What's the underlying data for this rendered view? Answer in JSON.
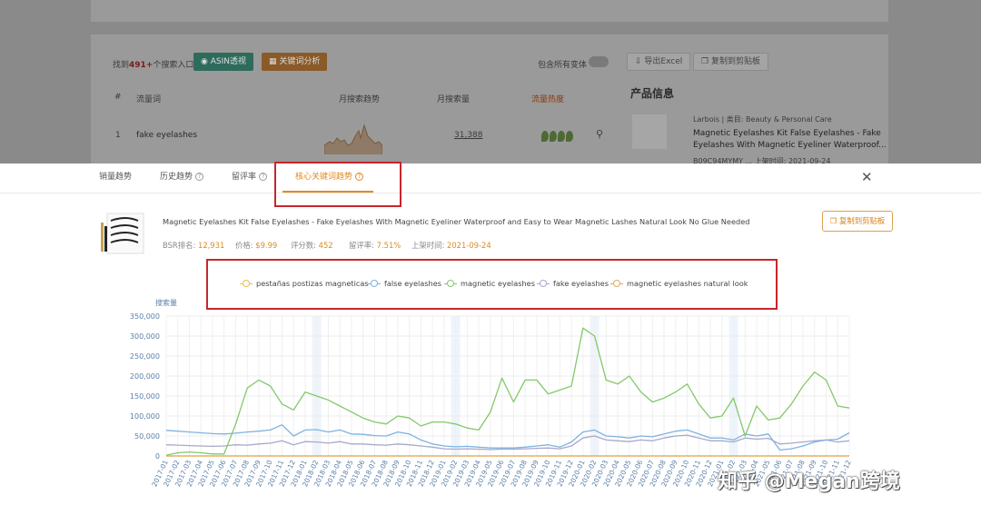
{
  "background": {
    "found_text": "找到",
    "found_count": "491+",
    "found_suffix": "个搜索入口",
    "asin_btn": "ASIN透视",
    "keyword_btn": "关键词分析",
    "include_variants": "包含所有变体",
    "export_btn": "导出Excel",
    "copy_btn": "复制到剪贴板",
    "col_hash": "#",
    "col_keyword": "流量词",
    "col_trend": "月搜索趋势",
    "col_volume": "月搜索量",
    "col_heat": "流量热度",
    "row1_index": "1",
    "row1_keyword": "fake eyelashes",
    "row1_volume": "31,388",
    "product_info_title": "产品信息",
    "brand_line": "Larbois | 类目: Beauty & Personal Care",
    "product_title_line1": "Magnetic Eyelashes Kit False Eyelashes - Fake",
    "product_title_line2": "Eyelashes With Magnetic Eyeliner Waterproof...",
    "product_line3": "B09C94MYMY ... 上架时间: 2021-09-24"
  },
  "tabs": [
    {
      "label": "销量趋势",
      "help": false
    },
    {
      "label": "历史趋势",
      "help": true
    },
    {
      "label": "留评率",
      "help": true
    },
    {
      "label": "核心关键词趋势",
      "help": true,
      "active": true
    }
  ],
  "product": {
    "title": "Magnetic Eyelashes Kit False Eyelashes - Fake Eyelashes With Magnetic Eyeliner Waterproof and Easy to Wear Magnetic Lashes Natural Look No Glue Needed",
    "bsr_label": "BSR排名:",
    "bsr_value": "12,931",
    "price_label": "价格:",
    "price_value": "$9.99",
    "reviews_label": "评分数:",
    "reviews_value": "452",
    "review_rate_label": "留评率:",
    "review_rate_value": "7.51%",
    "launch_label": "上架时间:",
    "launch_value": "2021-09-24",
    "copy_btn": "复制到剪贴板"
  },
  "watermark": "知乎 @Megan跨境",
  "chart_data": {
    "type": "line",
    "ylabel": "搜索量",
    "ylim": [
      0,
      350000
    ],
    "yticks": [
      "0",
      "50,000",
      "100,000",
      "150,000",
      "200,000",
      "250,000",
      "300,000",
      "350,000"
    ],
    "x": [
      "2017-01",
      "2017-02",
      "2017-03",
      "2017-04",
      "2017-05",
      "2017-06",
      "2017-07",
      "2017-08",
      "2017-09",
      "2017-10",
      "2017-11",
      "2017-12",
      "2018-01",
      "2018-02",
      "2018-03",
      "2018-04",
      "2018-05",
      "2018-06",
      "2018-07",
      "2018-08",
      "2018-09",
      "2018-10",
      "2018-11",
      "2018-12",
      "2019-01",
      "2019-02",
      "2019-03",
      "2019-04",
      "2019-05",
      "2019-06",
      "2019-07",
      "2019-08",
      "2019-09",
      "2019-10",
      "2019-11",
      "2019-12",
      "2020-01",
      "2020-02",
      "2020-03",
      "2020-04",
      "2020-05",
      "2020-06",
      "2020-07",
      "2020-08",
      "2020-09",
      "2020-10",
      "2020-11",
      "2020-12",
      "2021-01",
      "2021-02",
      "2021-03",
      "2021-04",
      "2021-05",
      "2021-06",
      "2021-07",
      "2021-08",
      "2021-09",
      "2021-10",
      "2021-11",
      "2021-12"
    ],
    "series": [
      {
        "name": "pestañas postizas magneticas",
        "color": "#e8c24a",
        "values": [
          0,
          0,
          0,
          0,
          0,
          0,
          0,
          0,
          0,
          0,
          0,
          0,
          0,
          0,
          0,
          0,
          0,
          0,
          0,
          0,
          0,
          0,
          0,
          0,
          0,
          0,
          0,
          0,
          0,
          0,
          0,
          0,
          0,
          0,
          0,
          0,
          0,
          0,
          0,
          0,
          0,
          0,
          0,
          0,
          0,
          0,
          0,
          0,
          0,
          0,
          0,
          0,
          0,
          0,
          0,
          0,
          0,
          0,
          0,
          0
        ]
      },
      {
        "name": "false eyelashes",
        "color": "#7fb3e0",
        "values": [
          64000,
          62000,
          60000,
          58000,
          56000,
          55000,
          57000,
          60000,
          62000,
          65000,
          78000,
          50000,
          65000,
          66000,
          60000,
          65000,
          55000,
          54000,
          51000,
          50000,
          60000,
          55000,
          40000,
          30000,
          25000,
          23000,
          24000,
          22000,
          20000,
          20000,
          20000,
          22000,
          25000,
          28000,
          22000,
          35000,
          60000,
          65000,
          50000,
          48000,
          45000,
          50000,
          48000,
          55000,
          62000,
          65000,
          55000,
          45000,
          45000,
          40000,
          55000,
          50000,
          55000,
          15000,
          18000,
          25000,
          35000,
          40000,
          42000,
          58000
        ]
      },
      {
        "name": "magnetic eyelashes",
        "color": "#82c96a",
        "values": [
          2000,
          8000,
          10000,
          8000,
          5000,
          5000,
          80000,
          170000,
          190000,
          175000,
          130000,
          115000,
          160000,
          150000,
          140000,
          125000,
          110000,
          95000,
          85000,
          80000,
          100000,
          95000,
          75000,
          85000,
          85000,
          80000,
          70000,
          65000,
          110000,
          195000,
          135000,
          190000,
          190000,
          155000,
          165000,
          175000,
          320000,
          300000,
          190000,
          180000,
          200000,
          160000,
          135000,
          145000,
          160000,
          180000,
          130000,
          95000,
          100000,
          145000,
          50000,
          125000,
          90000,
          95000,
          130000,
          175000,
          210000,
          190000,
          125000,
          120000
        ]
      },
      {
        "name": "fake eyelashes",
        "color": "#a8a8cc",
        "values": [
          28000,
          27000,
          26000,
          25000,
          24000,
          25000,
          28000,
          27000,
          30000,
          32000,
          38000,
          28000,
          36000,
          35000,
          32000,
          36000,
          30000,
          30000,
          28000,
          27000,
          30000,
          28000,
          25000,
          22000,
          18000,
          17000,
          18000,
          17000,
          16000,
          17000,
          17000,
          18000,
          19000,
          20000,
          18000,
          25000,
          45000,
          50000,
          40000,
          38000,
          36000,
          40000,
          38000,
          45000,
          50000,
          52000,
          45000,
          38000,
          38000,
          35000,
          45000,
          42000,
          44000,
          30000,
          32000,
          35000,
          38000,
          40000,
          35000,
          38000
        ]
      },
      {
        "name": "magnetic eyelashes natural look",
        "color": "#e4a85a",
        "values": [
          0,
          0,
          0,
          0,
          0,
          0,
          0,
          0,
          0,
          0,
          0,
          0,
          0,
          0,
          0,
          0,
          0,
          0,
          0,
          0,
          0,
          0,
          0,
          0,
          0,
          0,
          0,
          0,
          0,
          0,
          0,
          0,
          0,
          0,
          0,
          0,
          0,
          0,
          0,
          0,
          0,
          0,
          0,
          0,
          0,
          0,
          0,
          0,
          0,
          0,
          0,
          0,
          0,
          0,
          0,
          0,
          0,
          0,
          0,
          0
        ]
      }
    ]
  }
}
